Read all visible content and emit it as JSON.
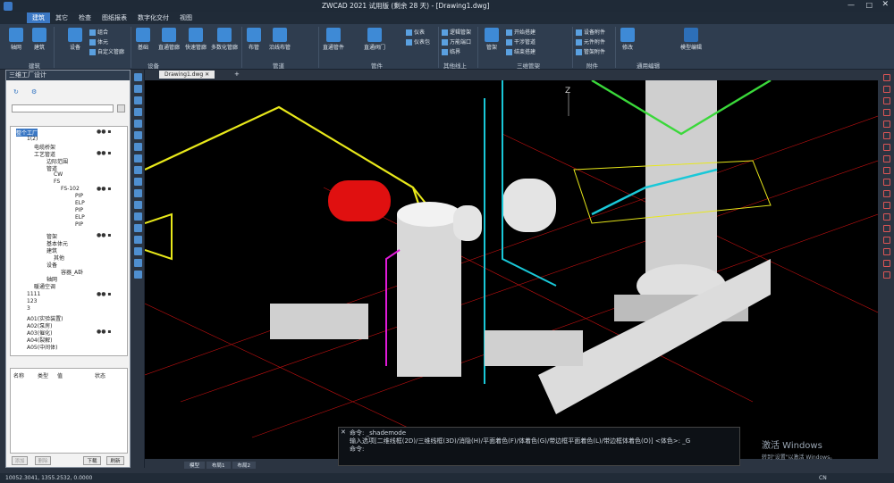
{
  "title": "ZWCAD 2021 试用版 (剩余 28 天) - [Drawing1.dwg]",
  "menu": [
    "建筑",
    "其它",
    "检查",
    "图纸报表",
    "数字化交付",
    "视图"
  ],
  "menu_active": "建筑",
  "ribbon": {
    "big": [
      "轴网",
      "建筑",
      "设备",
      "基础",
      "直通管廊",
      "快速管廊",
      "多数化管廊",
      "布管",
      "沿线布管",
      "直通管件",
      "直通阀门",
      "管架",
      "修改",
      "模型编辑"
    ],
    "small": [
      "组合",
      "体元",
      "自定义管廊",
      "仪表",
      "仪表包",
      "逻辑管架",
      "万能端口",
      "临界",
      "开始搭建",
      "干涉管道",
      "结束搭建",
      "设备附件",
      "元件附件",
      "管架附件"
    ],
    "groups": [
      "建筑",
      "设备",
      "管道",
      "管件",
      "其他线上",
      "三维管架",
      "附件",
      "通用编辑"
    ]
  },
  "panel": {
    "title": "三维工厂设计",
    "tree": [
      "整个工厂",
      "1(2)",
      "电缆桥架",
      "工艺管道",
      "边际范围",
      "管道",
      "CW",
      "FS",
      "FS-102",
      "PIP",
      "ELP",
      "PIP",
      "ELP",
      "PIP",
      "管架",
      "基本体元",
      "建筑",
      "其他",
      "设备",
      "容器_A卧",
      "轴网",
      "暖通空调",
      "1111",
      "123",
      "3",
      "A01(实验装置)",
      "A02(泵房)",
      "A03(催化)",
      "A04(裂解)",
      "A05(中间体)"
    ],
    "cols": [
      "名称",
      "类型",
      "值",
      "状态"
    ],
    "buttons": [
      "添加",
      "删除",
      "下载",
      "刷新"
    ]
  },
  "tab": "Drawing1.dwg",
  "axis_label": "Z",
  "cmd": {
    "line1": "命令: _shademode",
    "line2": "输入选项[二维线框(2D)/三维线框(3D)/消隐(H)/平面着色(F)/体着色(G)/带边框平面着色(L)/带边框体着色(O)] <体色>: _G",
    "line3": "命令:"
  },
  "layout_tabs": [
    "模型",
    "布局1",
    "布局2"
  ],
  "status": "10052.3041, 1355.2532, 0.0000",
  "watermark": {
    "title": "激活 Windows",
    "sub": "转到\"设置\"以激活 Windows。"
  },
  "ime": "CN"
}
